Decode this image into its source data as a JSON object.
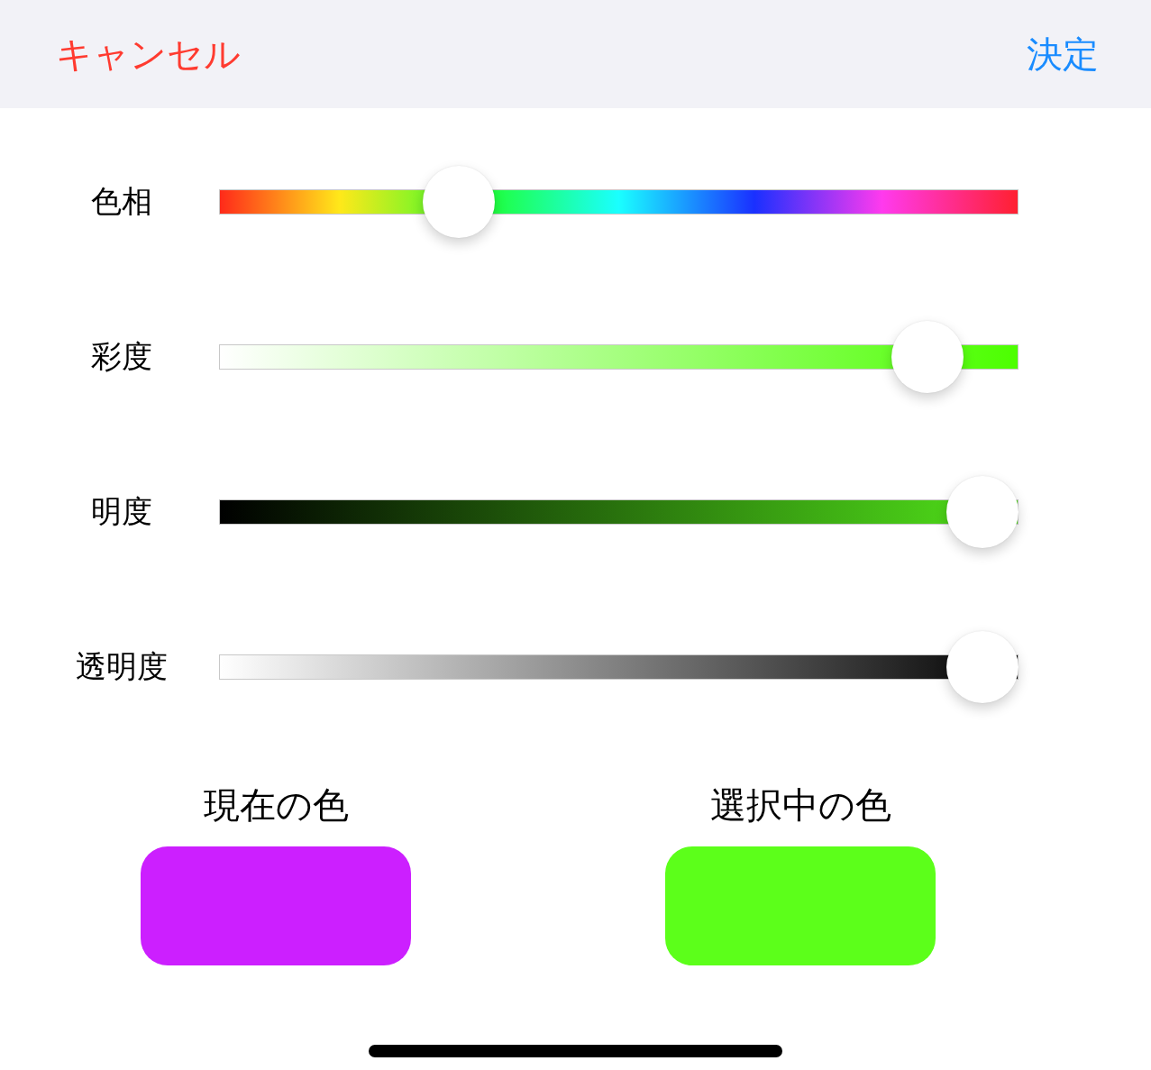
{
  "navigation_bar": {
    "cancel": "キャンセル",
    "confirm": "決定"
  },
  "sliders": [
    {
      "kind": "hue",
      "label": "色相",
      "level": 0.28
    },
    {
      "kind": "saturation",
      "label": "彩度",
      "level": 0.925
    },
    {
      "kind": "brightness",
      "label": "明度",
      "level": 1
    },
    {
      "kind": "alpha",
      "label": "透明度",
      "level": 1
    }
  ],
  "swatches": [
    {
      "label": "現在の色",
      "color": "#cc1fff"
    },
    {
      "label": "選択中の色",
      "color": "#5cff1a"
    }
  ]
}
